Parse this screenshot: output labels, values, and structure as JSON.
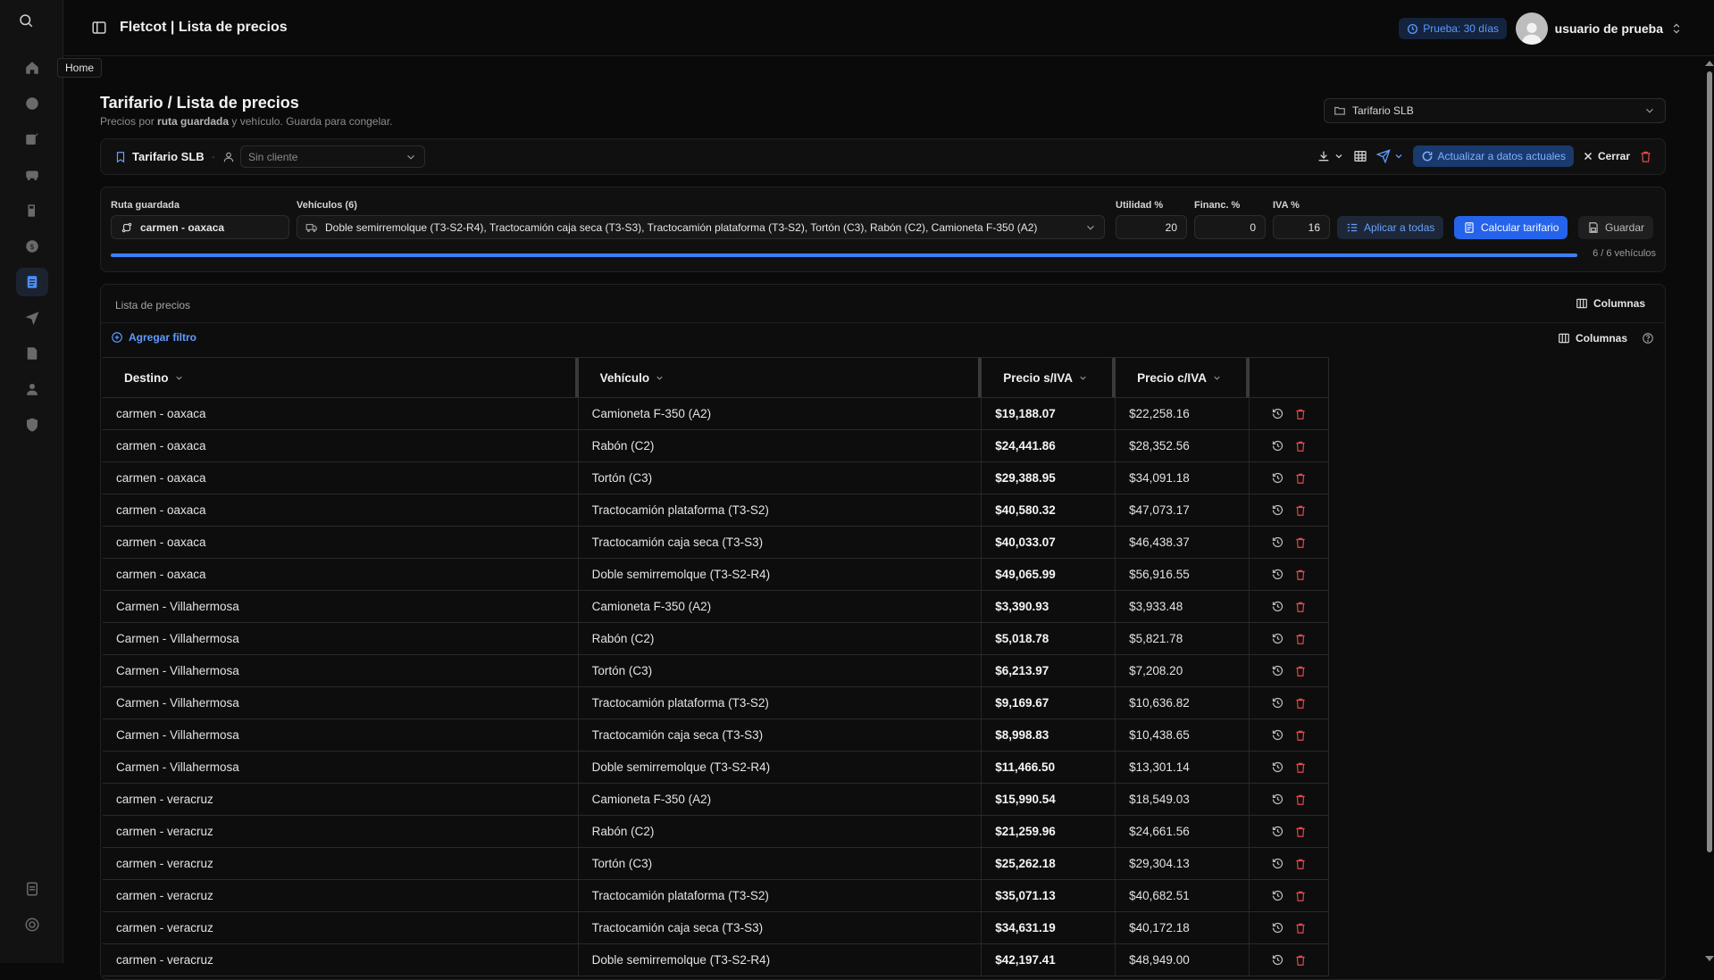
{
  "header": {
    "title": "Fletcot | Lista de precios",
    "trial": "Prueba: 30 días",
    "user": "usuario de prueba"
  },
  "sidebar": {
    "tooltip": "Home",
    "items": [
      "home-icon",
      "globe-icon",
      "edit-icon",
      "truck-icon",
      "fuel-icon",
      "dollar-icon",
      "price-list-icon",
      "send-icon",
      "document-icon",
      "user-icon",
      "shield-icon"
    ],
    "bottom": [
      "docs-icon",
      "support-icon"
    ]
  },
  "page": {
    "title": "Tarifario / Lista de precios",
    "subtitle_pre": "Precios por ",
    "subtitle_bold": "ruta guardada",
    "subtitle_post": " y vehículo. Guarda para congelar.",
    "tarifario_select": "Tarifario SLB"
  },
  "toolbar": {
    "name": "Tarifario SLB",
    "separator": "·",
    "client_placeholder": "Sin cliente",
    "update_label": "Actualizar a datos actuales",
    "close_label": "Cerrar"
  },
  "params": {
    "route_label": "Ruta guardada",
    "route_value": "carmen - oaxaca",
    "vehicles_label": "Vehículos (6)",
    "vehicles_value": "Doble semirremolque (T3-S2-R4), Tractocamión caja seca (T3-S3), Tractocamión plataforma (T3-S2), Tortón (C3), Rabón (C2), Camioneta F-350 (A2)",
    "utilidad_label": "Utilidad %",
    "utilidad_value": "20",
    "financ_label": "Financ. %",
    "financ_value": "0",
    "iva_label": "IVA %",
    "iva_value": "16",
    "apply_all": "Aplicar a todas",
    "calculate": "Calcular tarifario",
    "save": "Guardar",
    "progress_fraction": 1.0,
    "progress_label": "6 / 6 vehículos"
  },
  "list": {
    "title": "Lista de precios",
    "columns_label_top": "Columnas",
    "add_filter": "Agregar filtro",
    "columns_label": "Columnas",
    "headers": [
      "Destino",
      "Vehículo",
      "Precio s/IVA",
      "Precio c/IVA"
    ],
    "rows": [
      {
        "destino": "carmen - oaxaca",
        "vehiculo": "Camioneta F-350 (A2)",
        "sin_iva": "$19,188.07",
        "con_iva": "$22,258.16"
      },
      {
        "destino": "carmen - oaxaca",
        "vehiculo": "Rabón (C2)",
        "sin_iva": "$24,441.86",
        "con_iva": "$28,352.56"
      },
      {
        "destino": "carmen - oaxaca",
        "vehiculo": "Tortón (C3)",
        "sin_iva": "$29,388.95",
        "con_iva": "$34,091.18"
      },
      {
        "destino": "carmen - oaxaca",
        "vehiculo": "Tractocamión plataforma (T3-S2)",
        "sin_iva": "$40,580.32",
        "con_iva": "$47,073.17"
      },
      {
        "destino": "carmen - oaxaca",
        "vehiculo": "Tractocamión caja seca (T3-S3)",
        "sin_iva": "$40,033.07",
        "con_iva": "$46,438.37"
      },
      {
        "destino": "carmen - oaxaca",
        "vehiculo": "Doble semirremolque (T3-S2-R4)",
        "sin_iva": "$49,065.99",
        "con_iva": "$56,916.55"
      },
      {
        "destino": "Carmen - Villahermosa",
        "vehiculo": "Camioneta F-350 (A2)",
        "sin_iva": "$3,390.93",
        "con_iva": "$3,933.48"
      },
      {
        "destino": "Carmen - Villahermosa",
        "vehiculo": "Rabón (C2)",
        "sin_iva": "$5,018.78",
        "con_iva": "$5,821.78"
      },
      {
        "destino": "Carmen - Villahermosa",
        "vehiculo": "Tortón (C3)",
        "sin_iva": "$6,213.97",
        "con_iva": "$7,208.20"
      },
      {
        "destino": "Carmen - Villahermosa",
        "vehiculo": "Tractocamión plataforma (T3-S2)",
        "sin_iva": "$9,169.67",
        "con_iva": "$10,636.82"
      },
      {
        "destino": "Carmen - Villahermosa",
        "vehiculo": "Tractocamión caja seca (T3-S3)",
        "sin_iva": "$8,998.83",
        "con_iva": "$10,438.65"
      },
      {
        "destino": "Carmen - Villahermosa",
        "vehiculo": "Doble semirremolque (T3-S2-R4)",
        "sin_iva": "$11,466.50",
        "con_iva": "$13,301.14"
      },
      {
        "destino": "carmen - veracruz",
        "vehiculo": "Camioneta F-350 (A2)",
        "sin_iva": "$15,990.54",
        "con_iva": "$18,549.03"
      },
      {
        "destino": "carmen - veracruz",
        "vehiculo": "Rabón (C2)",
        "sin_iva": "$21,259.96",
        "con_iva": "$24,661.56"
      },
      {
        "destino": "carmen - veracruz",
        "vehiculo": "Tortón (C3)",
        "sin_iva": "$25,262.18",
        "con_iva": "$29,304.13"
      },
      {
        "destino": "carmen - veracruz",
        "vehiculo": "Tractocamión plataforma (T3-S2)",
        "sin_iva": "$35,071.13",
        "con_iva": "$40,682.51"
      },
      {
        "destino": "carmen - veracruz",
        "vehiculo": "Tractocamión caja seca (T3-S3)",
        "sin_iva": "$34,631.19",
        "con_iva": "$40,172.18"
      },
      {
        "destino": "carmen - veracruz",
        "vehiculo": "Doble semirremolque (T3-S2-R4)",
        "sin_iva": "$42,197.41",
        "con_iva": "$48,949.00"
      }
    ]
  },
  "colors": {
    "accent": "#2563eb",
    "danger": "#e5484d",
    "background": "#0a0a0a"
  }
}
